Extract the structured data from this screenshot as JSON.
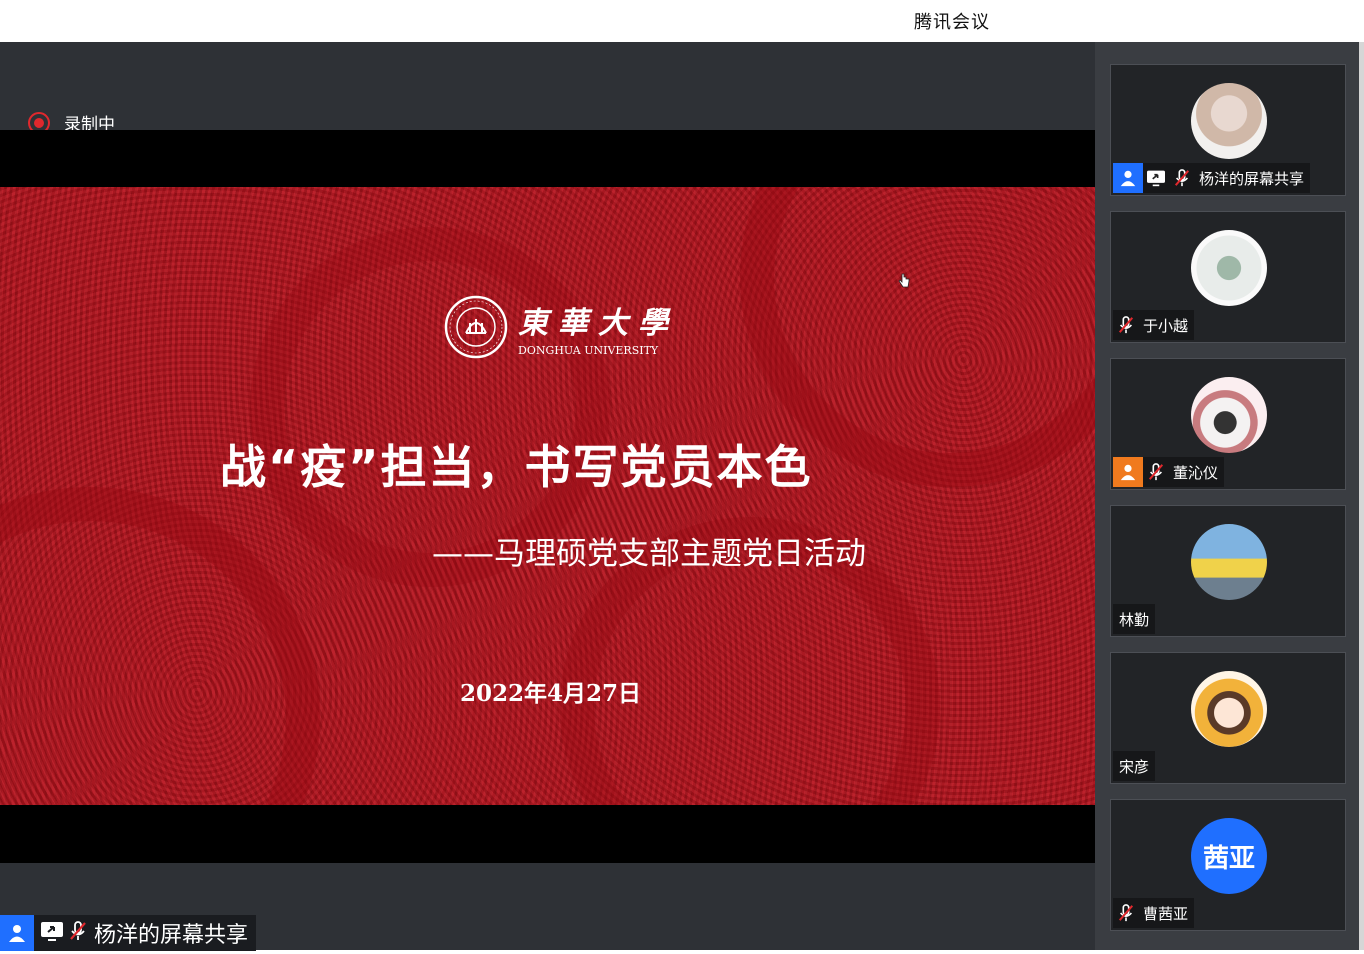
{
  "app": {
    "title": "腾讯会议"
  },
  "recording": {
    "label": "录制中"
  },
  "slide": {
    "logo_cn": "東華大學",
    "logo_en": "DONGHUA UNIVERSITY",
    "title": "战“疫”担当，书写党员本色",
    "subtitle": "——马理硕党支部主题党日活动",
    "date": "2022年4月27日"
  },
  "presenter": {
    "name": "杨洋的屏幕共享",
    "icons": [
      "user-icon",
      "screen-share-icon",
      "mic-muted-icon"
    ]
  },
  "participants": [
    {
      "name": "杨洋的屏幕共享",
      "avatar": "photo",
      "badge": "user-icon",
      "badge_color": "#1f6fff",
      "sharing": true,
      "muted": true
    },
    {
      "name": "于小越",
      "avatar": "cartoon",
      "muted": true
    },
    {
      "name": "董沁仪",
      "avatar": "cartoon",
      "badge": "user-icon",
      "badge_color": "#f07a1e",
      "muted": true
    },
    {
      "name": "林勤",
      "avatar": "photo",
      "muted": false
    },
    {
      "name": "宋彦",
      "avatar": "cartoon",
      "muted": false
    },
    {
      "name": "曹茜亚",
      "avatar_text": "茜亚",
      "avatar_color": "#1f6fff",
      "muted": true
    }
  ],
  "colors": {
    "accent": "#1f6fff",
    "record": "#e0282d",
    "slide_bg": "#b8141e",
    "host_badge": "#f07a1e"
  }
}
